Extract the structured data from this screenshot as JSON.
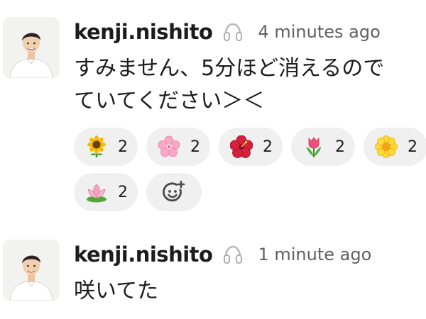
{
  "messages": [
    {
      "username": "kenji.nishito",
      "status_icon": "headphones-icon",
      "time": "4 minutes ago",
      "lines": [
        "すみません、5分ほど消えるので",
        "ていてください＞＜"
      ],
      "reactions": [
        {
          "emoji": "sunflower",
          "count": "2"
        },
        {
          "emoji": "cherry-blossom",
          "count": "2"
        },
        {
          "emoji": "hibiscus",
          "count": "2"
        },
        {
          "emoji": "tulip",
          "count": "2"
        },
        {
          "emoji": "blossom",
          "count": "2"
        },
        {
          "emoji": "lotus",
          "count": "2"
        }
      ],
      "add_reaction_icon": "add-reaction-icon"
    },
    {
      "username": "kenji.nishito",
      "status_icon": "headphones-icon",
      "time": "1 minute ago",
      "lines": [
        "咲いてた"
      ]
    }
  ],
  "colors": {
    "reaction_bg": "#f0f0f0",
    "time_text": "#616061",
    "text": "#1d1c1d"
  }
}
